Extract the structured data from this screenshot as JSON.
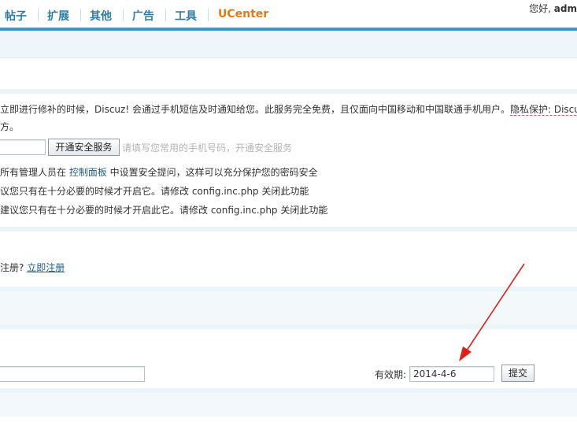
{
  "nav": {
    "items": [
      "帖子",
      "扩展",
      "其他",
      "广告",
      "工具"
    ],
    "ucenter": "UCenter",
    "greeting_prefix": "您好, ",
    "greeting_user": "adm"
  },
  "security": {
    "line1": "立即进行修补的时候，Discuz! 会通过手机短信及时通知给您。此服务完全免费，且仅面向中国移动和中国联通手机用户。",
    "privacy": "隐私保护: Discu",
    "line2": "方。",
    "open_button": "开通安全服务",
    "phone_hint": "请填写您常用的手机号码，开通安全服务",
    "admin_prefix": "所有管理人员在 ",
    "admin_link": "控制面板",
    "admin_suffix": " 中设置安全提问，这样可以充分保护您的密码安全",
    "tip1": "议您只有在十分必要的时候才开启它。请修改 config.inc.php 关闭此功能",
    "tip2": "建议您只有在十分必要的时候才开启此它。请修改 config.inc.php 关闭此功能"
  },
  "register": {
    "prefix": "注册? ",
    "link": "立即注册"
  },
  "form": {
    "validity_label": "有效期:",
    "validity_value": "2014-4-6",
    "submit_label": "提交"
  },
  "colors": {
    "nav_text": "#2f7da5",
    "ucenter": "#e07a12",
    "accent_bar": "#2f9dc6",
    "arrow": "#e0201a"
  }
}
